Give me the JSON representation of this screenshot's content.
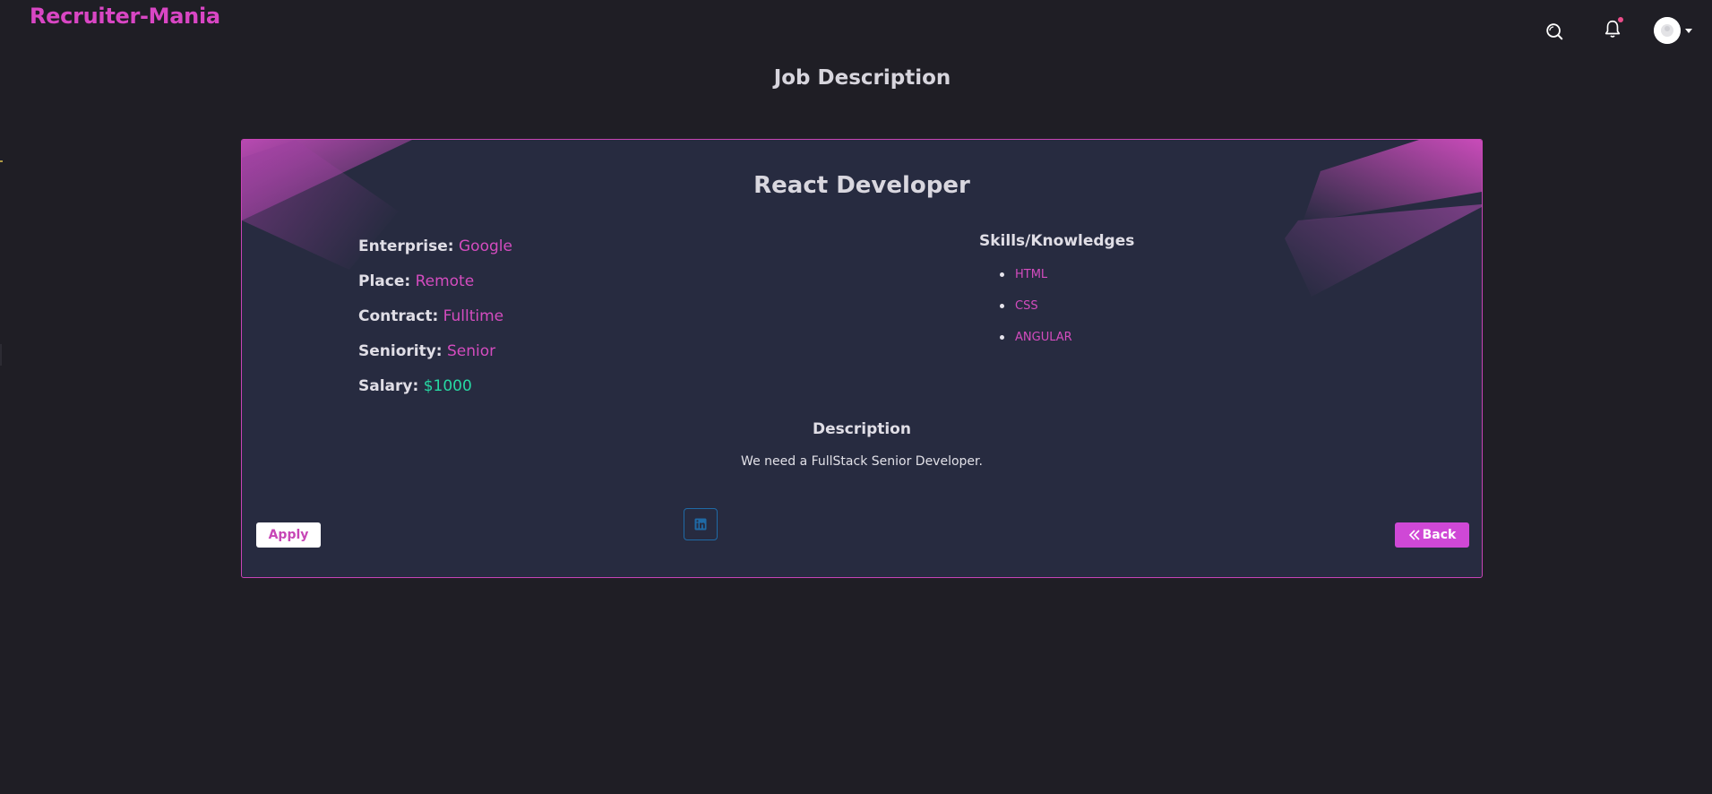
{
  "header": {
    "brand": "Recruiter-Mania",
    "icons": {
      "search": "search-icon",
      "notifications": "bell-icon",
      "avatar": "user-avatar-icon"
    }
  },
  "page": {
    "title": "Job Description"
  },
  "job": {
    "title": "React Developer",
    "details": [
      {
        "label": "Enterprise:",
        "value": "Google"
      },
      {
        "label": "Place:",
        "value": "Remote"
      },
      {
        "label": "Contract:",
        "value": "Fulltime"
      },
      {
        "label": "Seniority:",
        "value": "Senior"
      }
    ],
    "salary": {
      "label": "Salary:",
      "value": "$1000"
    },
    "skills_title": "Skills/Knowledges",
    "skills": [
      "HTML",
      "CSS",
      "ANGULAR"
    ],
    "description_title": "Description",
    "description": "We need a FullStack Senior Developer."
  },
  "actions": {
    "apply_label": "Apply",
    "back_label": "Back",
    "linkedin_icon": "linkedin-icon",
    "back_icon": "double-chevron-left-icon"
  },
  "colors": {
    "accent": "#d946c4",
    "background": "#1f1e25",
    "card": "#272b40",
    "salary": "#27d9a3",
    "linkedin": "#1f6aa6"
  }
}
